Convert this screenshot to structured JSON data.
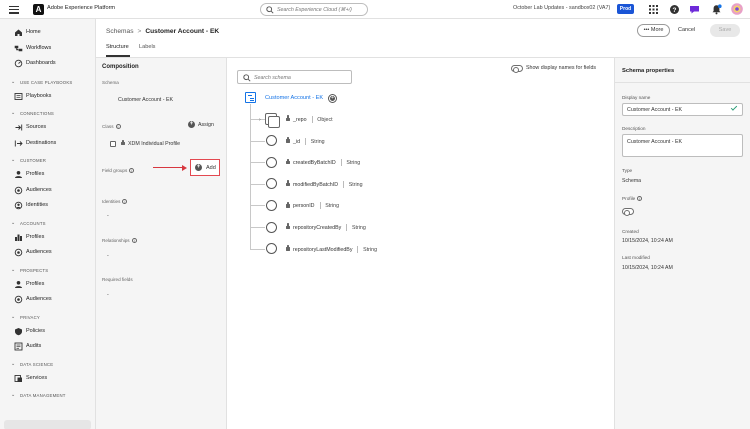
{
  "app": {
    "title": "Adobe Experience Platform",
    "search_placeholder": "Search Experience Cloud (⌘+/)",
    "sandbox": "October Lab Updates - sandbox02 (VA7)",
    "env_badge": "Prod",
    "brand_color": "#1473e6"
  },
  "sidebar": {
    "items": [
      {
        "label": "Home",
        "icon": "home-icon"
      },
      {
        "label": "Workflows",
        "icon": "workflows-icon"
      },
      {
        "label": "Dashboards",
        "icon": "dashboards-icon"
      }
    ],
    "sections": [
      {
        "title": "USE CASE PLAYBOOKS",
        "items": [
          {
            "label": "Playbooks",
            "icon": "playbooks-icon"
          }
        ]
      },
      {
        "title": "CONNECTIONS",
        "items": [
          {
            "label": "Sources",
            "icon": "sources-icon"
          },
          {
            "label": "Destinations",
            "icon": "destinations-icon"
          }
        ]
      },
      {
        "title": "CUSTOMER",
        "items": [
          {
            "label": "Profiles",
            "icon": "profile-icon"
          },
          {
            "label": "Audiences",
            "icon": "audiences-icon"
          },
          {
            "label": "Identities",
            "icon": "identities-icon"
          }
        ]
      },
      {
        "title": "ACCOUNTS",
        "items": [
          {
            "label": "Profiles",
            "icon": "account-profiles-icon"
          },
          {
            "label": "Audiences",
            "icon": "audiences-icon"
          }
        ]
      },
      {
        "title": "PROSPECTS",
        "items": [
          {
            "label": "Profiles",
            "icon": "profile-icon"
          },
          {
            "label": "Audiences",
            "icon": "audiences-icon"
          }
        ]
      },
      {
        "title": "PRIVACY",
        "items": [
          {
            "label": "Policies",
            "icon": "policies-icon"
          },
          {
            "label": "Audits",
            "icon": "audits-icon"
          }
        ]
      },
      {
        "title": "DATA SCIENCE",
        "items": [
          {
            "label": "Services",
            "icon": "services-icon"
          }
        ]
      },
      {
        "title": "DATA MANAGEMENT",
        "items": []
      }
    ]
  },
  "header": {
    "breadcrumb_parent": "Schemas",
    "breadcrumb_sep": ">",
    "breadcrumb_current": "Customer Account - EK",
    "more_label": "More",
    "cancel_label": "Cancel",
    "save_label": "Save",
    "tabs": [
      {
        "label": "Structure",
        "active": true
      },
      {
        "label": "Labels",
        "active": false
      }
    ]
  },
  "composition": {
    "title": "Composition",
    "schema_label": "Schema",
    "schema_value": "Customer Account - EK",
    "class_label": "Class",
    "assign_label": "Assign",
    "class_value": "XDM Individual Profile",
    "field_groups_label": "Field groups",
    "add_label": "Add",
    "identities_label": "Identities",
    "identities_value": "-",
    "relationships_label": "Relationships",
    "relationships_value": "-",
    "required_fields_label": "Required fields",
    "required_fields_value": "-"
  },
  "canvas": {
    "search_placeholder": "Search schema",
    "display_names_label": "Show display names for fields",
    "root_label": "Customer Account - EK",
    "fields": [
      {
        "name": "_repo",
        "type": "Object",
        "locked": true,
        "expandable": true
      },
      {
        "name": "_id",
        "type": "String",
        "locked": true
      },
      {
        "name": "createdByBatchID",
        "type": "String",
        "locked": true
      },
      {
        "name": "modifiedByBatchID",
        "type": "String",
        "locked": true
      },
      {
        "name": "personID",
        "type": "String",
        "locked": true
      },
      {
        "name": "repositoryCreatedBy",
        "type": "String",
        "locked": true
      },
      {
        "name": "repositoryLastModifiedBy",
        "type": "String",
        "locked": true
      }
    ]
  },
  "properties": {
    "title": "Schema properties",
    "display_name_label": "Display name",
    "display_name_value": "Customer Account - EK",
    "description_label": "Description",
    "description_value": "Customer Account - EK",
    "type_label": "Type",
    "type_value": "Schema",
    "profile_label": "Profile",
    "profile_enabled": false,
    "created_label": "Created",
    "created_value": "10/15/2024, 10:24 AM",
    "modified_label": "Last modified",
    "modified_value": "10/15/2024, 10:24 AM"
  }
}
